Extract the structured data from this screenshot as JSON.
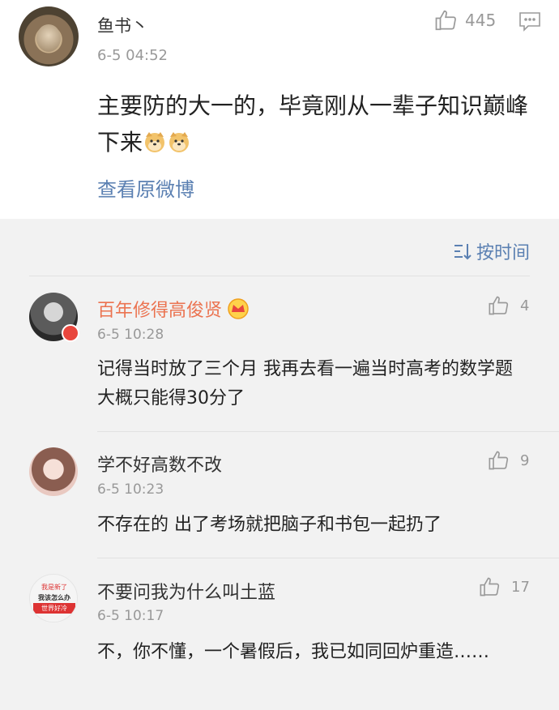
{
  "main_comment": {
    "author": "鱼书丶",
    "time": "6-5 04:52",
    "like_count": "445",
    "text": "主要防的大一的，毕竟刚从一辈子知识巅峰下来",
    "emoji": [
      "doge",
      "doge"
    ],
    "view_original": "查看原微博"
  },
  "sort_label": "按时间",
  "replies": [
    {
      "author": "百年修得高俊贤",
      "time": "6-5 10:28",
      "like_count": "4",
      "text": "记得当时放了三个月 我再去看一遍当时高考的数学题   大概只能得30分了"
    },
    {
      "author": "学不好高数不改",
      "time": "6-5 10:23",
      "like_count": "9",
      "text": "不存在的 出了考场就把脑子和书包一起扔了"
    },
    {
      "author": "不要问我为什么叫土蓝",
      "time": "6-5 10:17",
      "like_count": "17",
      "text": "不，你不懂，一个暑假后，我已如同回炉重造……"
    }
  ],
  "avatar4_text": [
    "我是新了",
    "我该怎么办",
    "世界好冷"
  ],
  "colors": {
    "link": "#5b80b2",
    "vip_name": "#eb7350",
    "meta": "#999999"
  }
}
